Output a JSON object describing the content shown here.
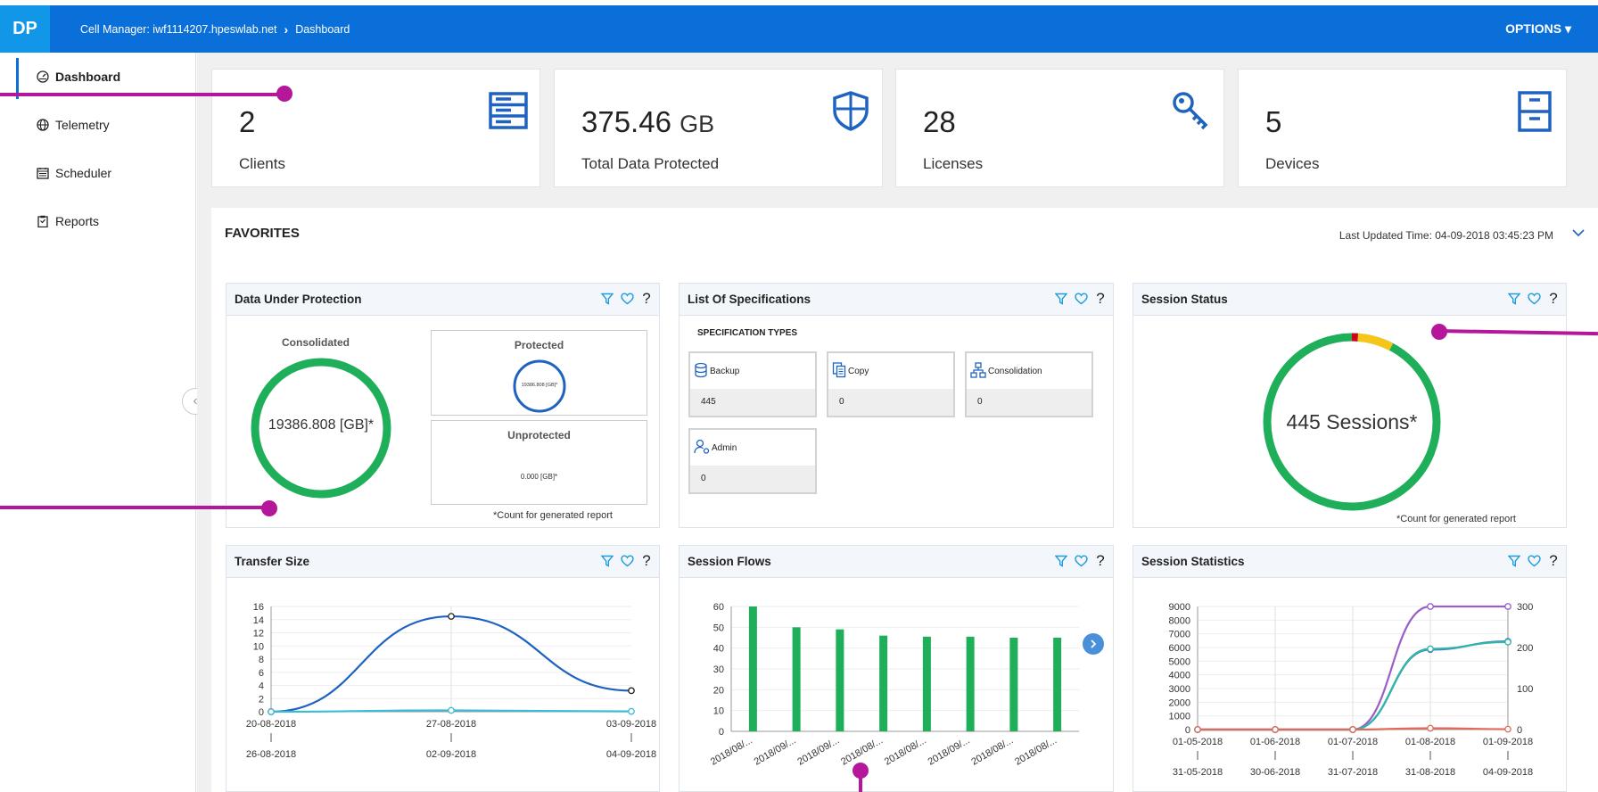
{
  "header": {
    "logo": "DP",
    "breadcrumb_cell": "Cell Manager: iwf1114207.hpeswlab.net",
    "breadcrumb_page": "Dashboard",
    "options": "OPTIONS ▾"
  },
  "sidebar": {
    "items": [
      {
        "label": "Dashboard",
        "icon": "dashboard-icon"
      },
      {
        "label": "Telemetry",
        "icon": "globe-icon"
      },
      {
        "label": "Scheduler",
        "icon": "calendar-icon"
      },
      {
        "label": "Reports",
        "icon": "clipboard-icon"
      }
    ]
  },
  "stats": [
    {
      "value": "2",
      "unit": "",
      "label": "Clients",
      "icon": "server-icon"
    },
    {
      "value": "375.46",
      "unit": "GB",
      "label": "Total Data Protected",
      "icon": "shield-icon"
    },
    {
      "value": "28",
      "unit": "",
      "label": "Licenses",
      "icon": "key-icon"
    },
    {
      "value": "5",
      "unit": "",
      "label": "Devices",
      "icon": "cabinet-icon"
    }
  ],
  "favorites": {
    "title": "FAVORITES",
    "last_updated": "Last Updated Time: 04-09-2018 03:45:23 PM"
  },
  "panels": {
    "dup": {
      "title": "Data Under Protection",
      "consolidated_label": "Consolidated",
      "consolidated_value": "19386.808 [GB]*",
      "protected_label": "Protected",
      "protected_value": "19386.808 [GB]*",
      "unprotected_label": "Unprotected",
      "unprotected_value": "0.000 [GB]*",
      "footnote": "*Count for generated report"
    },
    "specs": {
      "title": "List Of Specifications",
      "subtitle": "SPECIFICATION TYPES",
      "items": [
        {
          "label": "Backup",
          "value": "445",
          "icon": "backup-icon"
        },
        {
          "label": "Copy",
          "value": "0",
          "icon": "copy-icon"
        },
        {
          "label": "Consolidation",
          "value": "0",
          "icon": "consolidation-icon"
        },
        {
          "label": "Admin",
          "value": "0",
          "icon": "admin-icon"
        }
      ]
    },
    "session_status": {
      "title": "Session Status",
      "value": "445 Sessions*",
      "footnote": "*Count for generated report",
      "colors": {
        "ok": "#1fae5a",
        "warn": "#f5c518",
        "err": "#d0021b"
      }
    },
    "transfer": {
      "title": "Transfer Size"
    },
    "flows": {
      "title": "Session Flows"
    },
    "stats": {
      "title": "Session Statistics"
    }
  },
  "chart_data": [
    {
      "type": "line",
      "title": "",
      "x": [
        [
          "20-08-2018",
          "26-08-2018"
        ],
        [
          "27-08-2018",
          "02-09-2018"
        ],
        [
          "03-09-2018",
          "04-09-2018"
        ]
      ],
      "series": [
        {
          "color": "#1f63c0",
          "values": [
            0,
            14.5,
            3.2
          ]
        },
        {
          "color": "#3bbcd6",
          "values": [
            0,
            0.2,
            0.05
          ]
        }
      ],
      "ylim": [
        0,
        16
      ],
      "yticks": [
        0,
        2,
        4,
        6,
        8,
        10,
        12,
        14,
        16
      ],
      "grid": true
    },
    {
      "type": "bar",
      "title": "",
      "categories": [
        "2018/08/...",
        "2018/09/...",
        "2018/09/...",
        "2018/08/...",
        "2018/08/...",
        "2018/09/...",
        "2018/08/...",
        "2018/08/..."
      ],
      "values": [
        60,
        50,
        49,
        46,
        45.5,
        45.5,
        45,
        45
      ],
      "color": "#1fae5a",
      "ylim": [
        0,
        60
      ],
      "yticks": [
        0,
        10,
        20,
        30,
        40,
        50,
        60
      ],
      "grid": true
    },
    {
      "type": "line",
      "title": "",
      "x": [
        [
          "01-05-2018",
          "31-05-2018"
        ],
        [
          "01-06-2018",
          "30-06-2018"
        ],
        [
          "01-07-2018",
          "31-07-2018"
        ],
        [
          "01-08-2018",
          "31-08-2018"
        ],
        [
          "01-09-2018",
          "04-09-2018"
        ]
      ],
      "series": [
        {
          "axis": "right",
          "color": "#9a5fc7",
          "values": [
            0,
            0,
            0,
            300,
            300
          ]
        },
        {
          "axis": "right",
          "color": "#4a6fd0",
          "values": [
            0,
            0,
            0,
            195,
            215
          ]
        },
        {
          "axis": "left",
          "color": "#2fb7a5",
          "values": [
            0,
            0,
            0,
            5900,
            6400
          ]
        },
        {
          "axis": "left",
          "color": "#e06a5a",
          "values": [
            0,
            0,
            0,
            100,
            30
          ]
        }
      ],
      "ylim": [
        0,
        9000
      ],
      "yticks": [
        0,
        1000,
        2000,
        3000,
        4000,
        5000,
        6000,
        7000,
        8000,
        9000
      ],
      "y2lim": [
        0,
        300
      ],
      "y2ticks": [
        0,
        100,
        200,
        300
      ],
      "grid": true
    }
  ]
}
